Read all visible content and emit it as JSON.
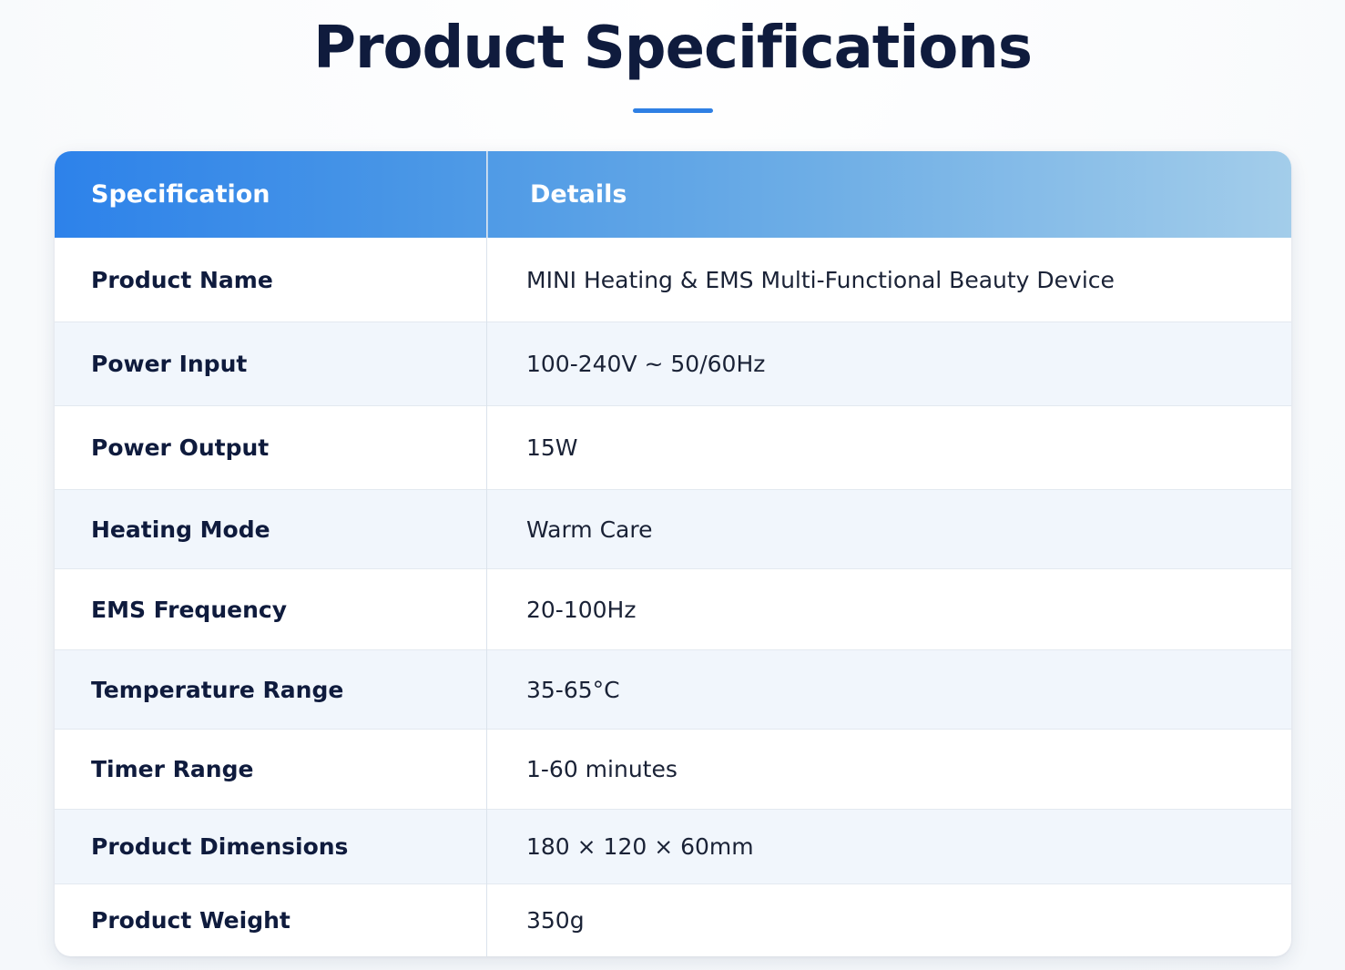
{
  "page": {
    "title": "Product Specifications"
  },
  "colors": {
    "title": "#0f1b3d",
    "accent": "#2f80e4",
    "header_gradient_start": "#2d82ea",
    "header_gradient_end": "#a3cdea",
    "alt_row": "#f1f6fc"
  },
  "table": {
    "headers": {
      "specification": "Specification",
      "details": "Details"
    },
    "rows": [
      {
        "label": "Product Name",
        "value": "MINI Heating & EMS Multi-Functional Beauty Device"
      },
      {
        "label": "Power Input",
        "value": "100-240V ~ 50/60Hz"
      },
      {
        "label": "Power Output",
        "value": "15W"
      },
      {
        "label": "Heating Mode",
        "value": "Warm Care"
      },
      {
        "label": "EMS Frequency",
        "value": "20-100Hz"
      },
      {
        "label": "Temperature Range",
        "value": "35-65°C"
      },
      {
        "label": "Timer Range",
        "value": "1-60 minutes"
      },
      {
        "label": "Product Dimensions",
        "value": "180 × 120 × 60mm"
      },
      {
        "label": "Product Weight",
        "value": "350g"
      }
    ]
  }
}
